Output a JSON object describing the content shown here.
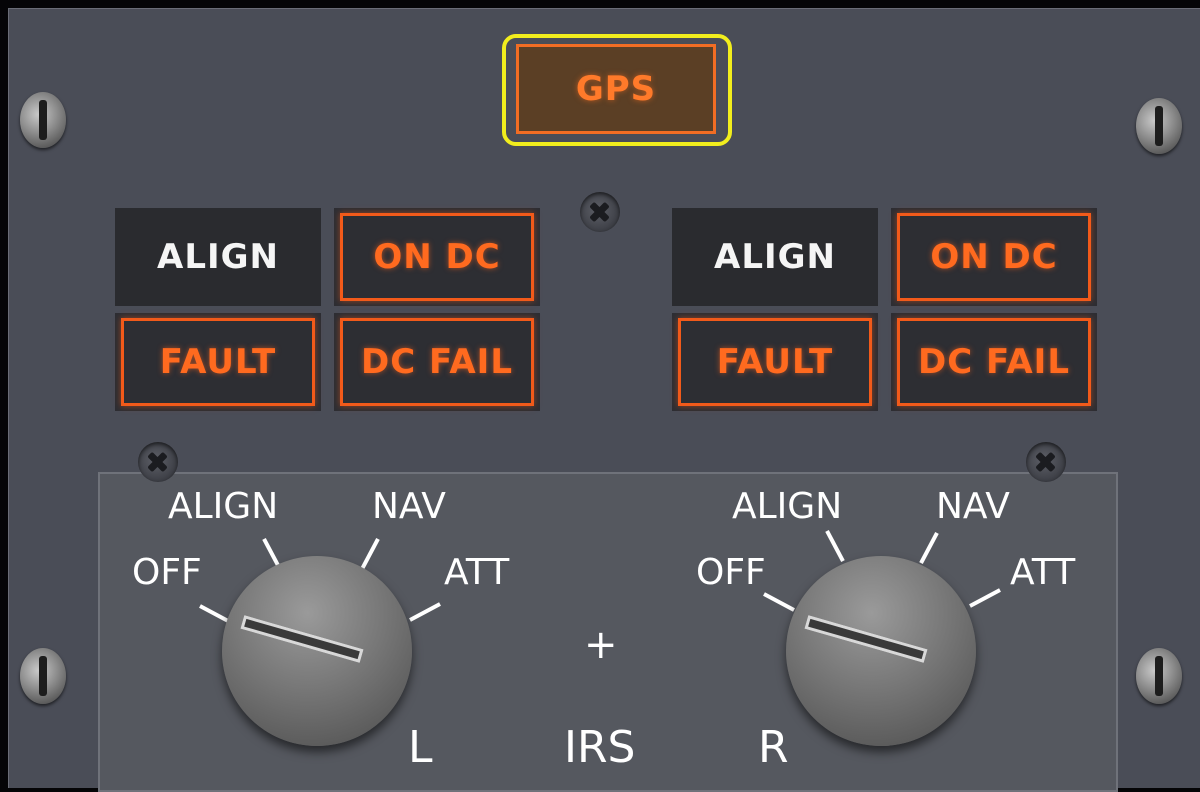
{
  "gps": {
    "label": "GPS",
    "status": "lit"
  },
  "left_irs": {
    "align": "ALIGN",
    "on_dc": "ON DC",
    "fault": "FAULT",
    "dc_fail": "DC FAIL"
  },
  "right_irs": {
    "align": "ALIGN",
    "on_dc": "ON DC",
    "fault": "FAULT",
    "dc_fail": "DC FAIL"
  },
  "selector": {
    "positions": [
      "OFF",
      "ALIGN",
      "NAV",
      "ATT"
    ],
    "left_label": "L",
    "right_label": "R",
    "center_label": "IRS",
    "center_mark": "+",
    "left_selected": "OFF",
    "right_selected": "OFF"
  },
  "colors": {
    "panel": "#4a4d57",
    "annunciator_lit": "#ff6a1f",
    "highlight": "#f2ee1d"
  }
}
